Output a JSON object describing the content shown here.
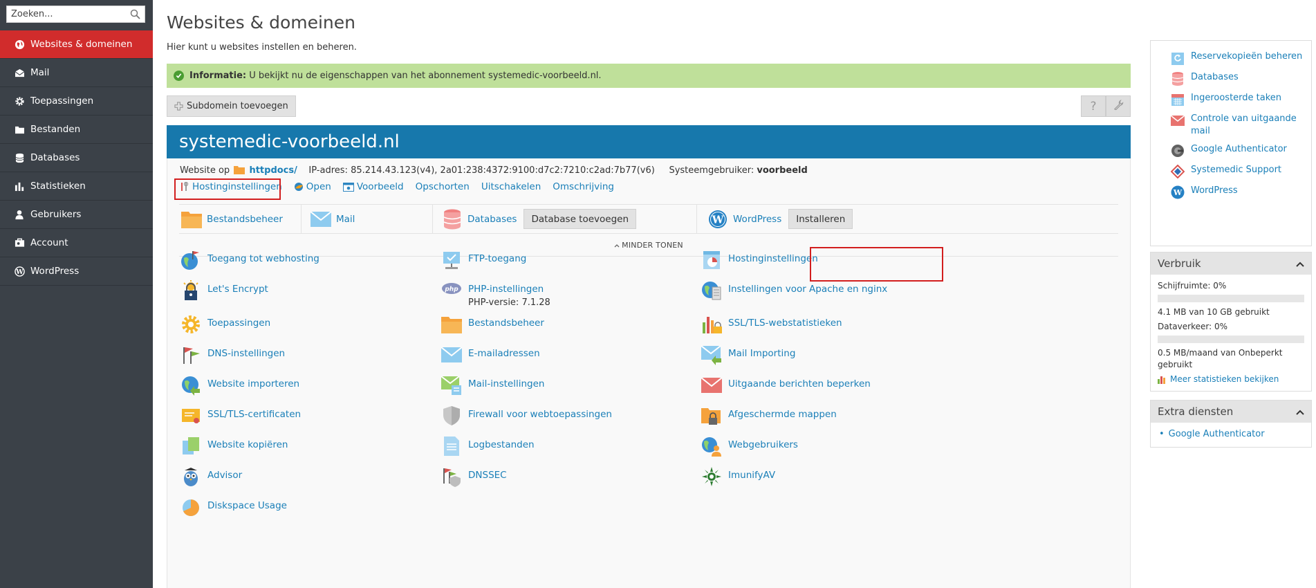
{
  "sidebar": {
    "search_placeholder": "Zoeken...",
    "items": [
      {
        "label": "Websites & domeinen",
        "icon": "globe-icon",
        "active": true
      },
      {
        "label": "Mail",
        "icon": "mail-icon"
      },
      {
        "label": "Toepassingen",
        "icon": "gear-icon"
      },
      {
        "label": "Bestanden",
        "icon": "folder-icon"
      },
      {
        "label": "Databases",
        "icon": "database-icon"
      },
      {
        "label": "Statistieken",
        "icon": "bar-chart-icon"
      },
      {
        "label": "Gebruikers",
        "icon": "user-icon"
      },
      {
        "label": "Account",
        "icon": "account-icon"
      },
      {
        "label": "WordPress",
        "icon": "wordpress-icon"
      }
    ]
  },
  "main": {
    "title": "Websites & domeinen",
    "description": "Hier kunt u websites instellen en beheren.",
    "info": {
      "label": "Informatie:",
      "text": "U bekijkt nu de eigenschappen van het abonnement systemedic-voorbeeld.nl."
    },
    "toolbar": {
      "add_subdomain": "Subdomein toevoegen",
      "help": "?"
    },
    "domain": {
      "name": "systemedic-voorbeeld.nl",
      "website_on": "Website op",
      "docroot": "httpdocs/",
      "ip_label": "IP-adres:",
      "ip_value": "85.214.43.123(v4), 2a01:238:4372:9100:d7c2:7210:c2ad:7b77(v6)",
      "sysuser_label": "Systeemgebruiker:",
      "sysuser_value": "voorbeeld",
      "actions": [
        "Hostinginstellingen",
        "Open",
        "Voorbeeld",
        "Opschorten",
        "Uitschakelen",
        "Omschrijving"
      ],
      "quick": {
        "filemanager": "Bestandsbeheer",
        "mail": "Mail",
        "databases": "Databases",
        "add_database": "Database toevoegen",
        "wordpress": "WordPress",
        "install": "Installeren"
      },
      "less": "MINDER TONEN",
      "tools": {
        "col1": [
          "Toegang tot webhosting",
          "Let's Encrypt",
          "Toepassingen",
          "DNS-instellingen",
          "Website importeren",
          "SSL/TLS-certificaten",
          "Website kopiëren",
          "Advisor",
          "Diskspace Usage"
        ],
        "col2": [
          "FTP-toegang",
          "PHP-instellingen",
          "Bestandsbeheer",
          "E-mailadressen",
          "Mail-instellingen",
          "Firewall voor webtoepassingen",
          "Logbestanden",
          "DNSSEC"
        ],
        "php_version": "PHP-versie: 7.1.28",
        "col3": [
          "Hostinginstellingen",
          "Instellingen voor Apache en nginx",
          "SSL/TLS-webstatistieken",
          "Mail Importing",
          "Uitgaande berichten beperken",
          "Afgeschermde mappen",
          "Webgebruikers",
          "ImunifyAV"
        ]
      }
    }
  },
  "right": {
    "links": [
      "Reservekopieën beheren",
      "Databases",
      "Ingeroosterde taken",
      "Controle van uitgaande mail",
      "Google Authenticator",
      "Systemedic Support",
      "WordPress"
    ],
    "usage": {
      "title": "Verbruik",
      "disk_label": "Schijfruimte:",
      "disk_pct": "0%",
      "disk_detail": "4.1 MB van 10 GB gebruikt",
      "traffic_label": "Dataverkeer:",
      "traffic_pct": "0%",
      "traffic_detail": "0.5 MB/maand van Onbeperkt gebruikt",
      "more_stats": "Meer statistieken bekijken"
    },
    "extra": {
      "title": "Extra diensten",
      "items": [
        "Google Authenticator"
      ]
    }
  },
  "colors": {
    "sidebar_bg": "#3b4148",
    "active_red": "#d12c2c",
    "domain_header": "#1778ac",
    "info_green": "#bfe09a",
    "link_blue": "#1a7fb8"
  }
}
